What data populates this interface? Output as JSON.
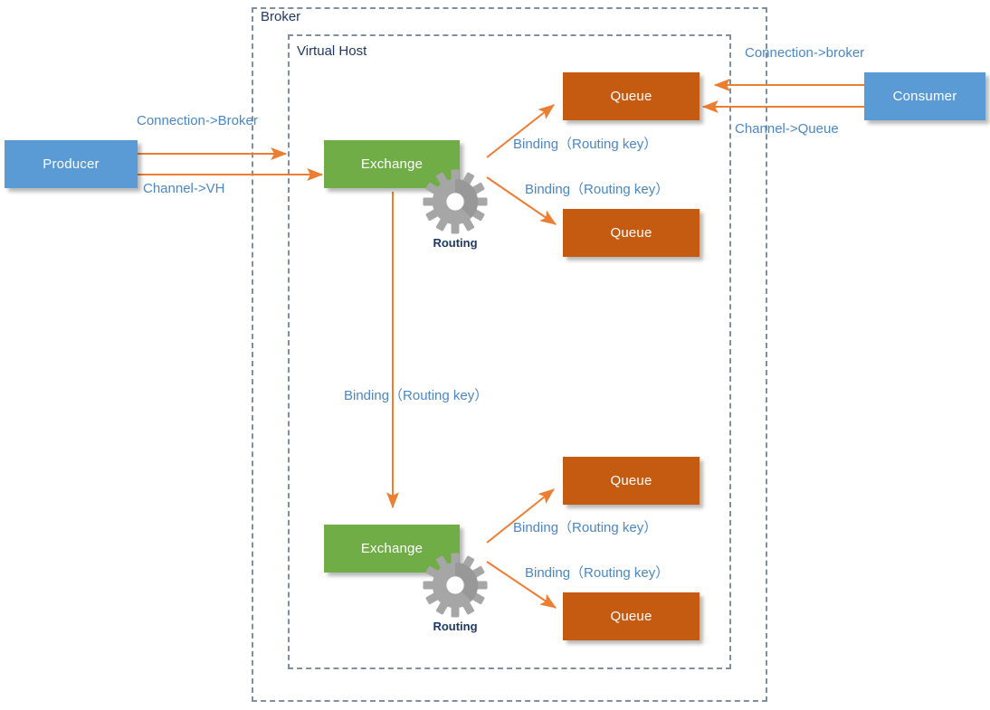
{
  "diagram": {
    "title": "RabbitMQ broker architecture diagram",
    "colors": {
      "producer_consumer": "#5B9BD5",
      "exchange": "#70AD47",
      "queue": "#C55A11",
      "arrow": "#ED7D31",
      "dashed_border": "#7F8F9F",
      "label_text": "#4A87C6",
      "container_label_text": "#1F3864"
    }
  },
  "containers": [
    {
      "id": "broker",
      "label": "Broker"
    },
    {
      "id": "virtual-host",
      "label": "Virtual Host"
    }
  ],
  "nodes": {
    "producer": {
      "label": "Producer"
    },
    "consumer": {
      "label": "Consumer"
    },
    "exchange_top": {
      "label": "Exchange"
    },
    "exchange_bottom": {
      "label": "Exchange"
    },
    "queue_1": {
      "label": "Queue"
    },
    "queue_2": {
      "label": "Queue"
    },
    "queue_3": {
      "label": "Queue"
    },
    "queue_4": {
      "label": "Queue"
    }
  },
  "gears": {
    "routing_top": {
      "label": "Routing",
      "icon": "gear-icon"
    },
    "routing_bottom": {
      "label": "Routing",
      "icon": "gear-icon"
    }
  },
  "edge_labels": {
    "producer_connection": "Connection->Broker",
    "producer_channel": "Channel->VH",
    "consumer_connection": "Connection->broker",
    "consumer_channel": "Channel->Queue",
    "binding_top_1": "Binding（Routing key）",
    "binding_top_2": "Binding（Routing key）",
    "binding_exchange_to_exchange": "Binding（Routing key）",
    "binding_bottom_1": "Binding（Routing key）",
    "binding_bottom_2": "Binding（Routing key）"
  }
}
